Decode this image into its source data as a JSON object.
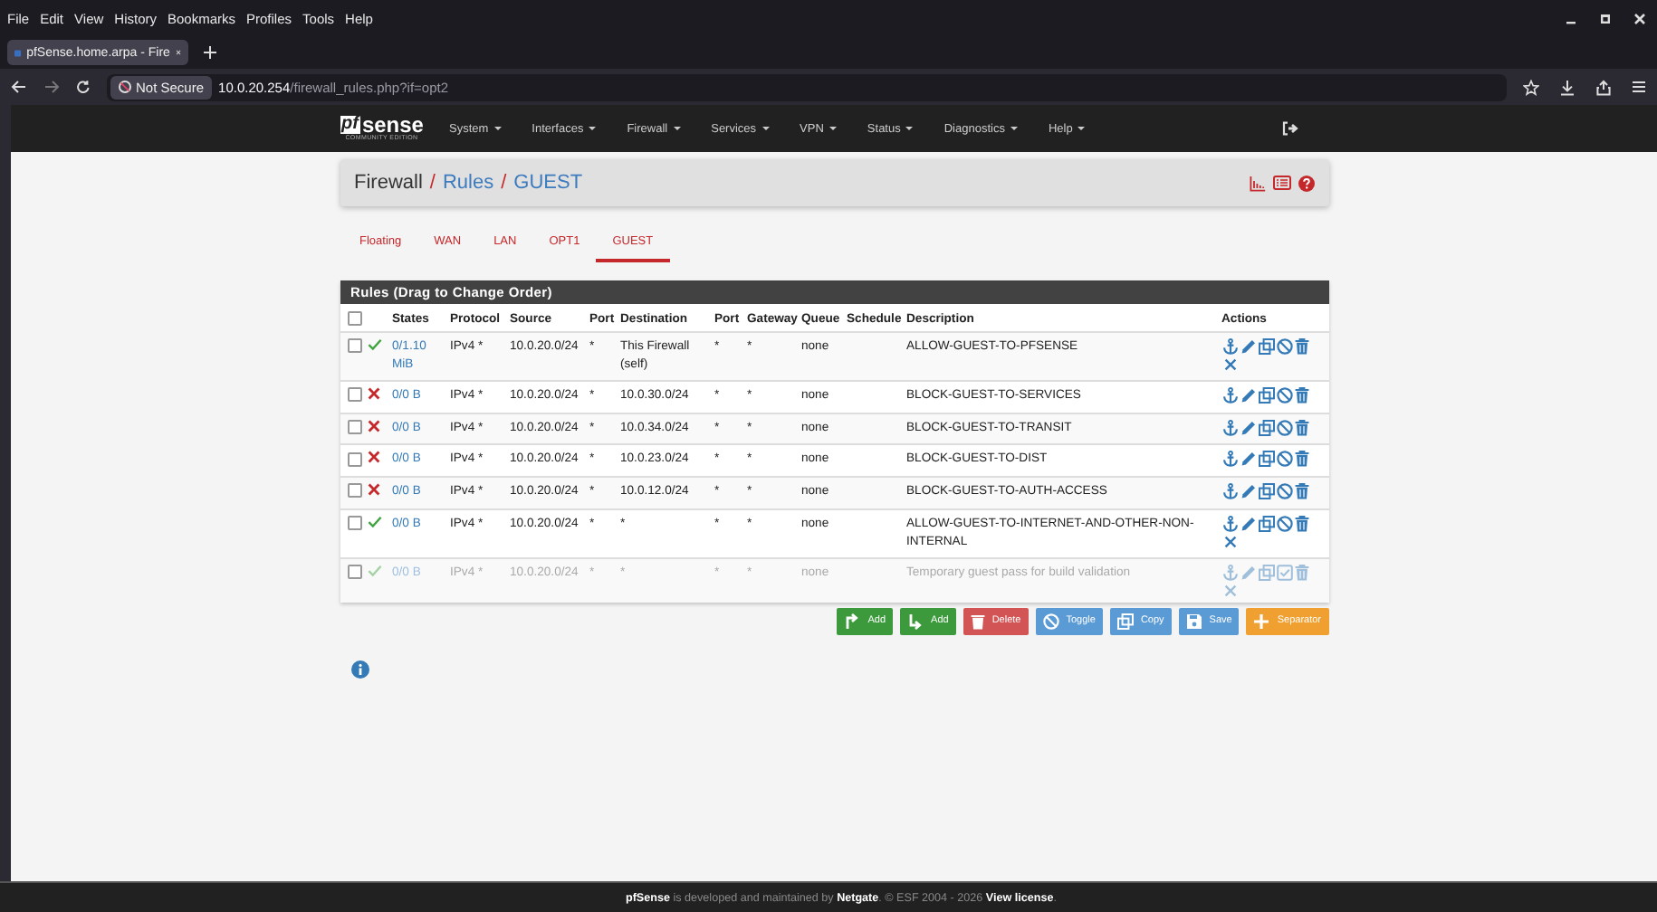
{
  "browser": {
    "menu": [
      "File",
      "Edit",
      "View",
      "History",
      "Bookmarks",
      "Profiles",
      "Tools",
      "Help"
    ],
    "tab": {
      "title": "pfSense.home.arpa - Fire",
      "selected": true
    },
    "address": {
      "security": "Not Secure",
      "host": "10.0.20.254",
      "path": "/firewall_rules.php?if=opt2"
    }
  },
  "navbar": {
    "logo": {
      "mark": "pf",
      "word": "sense",
      "edition": "COMMUNITY EDITION"
    },
    "menus": [
      "System",
      "Interfaces",
      "Firewall",
      "Services",
      "VPN",
      "Status",
      "Diagnostics",
      "Help"
    ]
  },
  "breadcrumb": {
    "separator": "/",
    "items": [
      {
        "text": "Firewall",
        "kind": "plain"
      },
      {
        "text": "Rules",
        "kind": "link"
      },
      {
        "text": "GUEST",
        "kind": "link"
      }
    ]
  },
  "tabs": [
    {
      "label": "Floating",
      "selected": false
    },
    {
      "label": "WAN",
      "selected": false
    },
    {
      "label": "LAN",
      "selected": false
    },
    {
      "label": "OPT1",
      "selected": false
    },
    {
      "label": "GUEST",
      "selected": true
    }
  ],
  "rules": {
    "title": "Rules (Drag to Change Order)",
    "select_all_checked": false,
    "columns": [
      "States",
      "Protocol",
      "Source",
      "Port",
      "Destination",
      "Port",
      "Gateway",
      "Queue",
      "Schedule",
      "Description",
      "Actions"
    ],
    "rows": [
      {
        "checked": false,
        "passes": true,
        "disabled": false,
        "states": "0/1.10 MiB",
        "protocol": "IPv4 *",
        "source": "10.0.20.0/24",
        "source_port": "*",
        "destination": "This Firewall (self)",
        "destination_port": "*",
        "gateway": "*",
        "queue": "none",
        "description": "ALLOW-GUEST-TO-PFSENSE",
        "x_action": true
      },
      {
        "checked": false,
        "passes": false,
        "disabled": false,
        "states": "0/0 B",
        "protocol": "IPv4 *",
        "source": "10.0.20.0/24",
        "source_port": "*",
        "destination": "10.0.30.0/24",
        "destination_port": "*",
        "gateway": "*",
        "queue": "none",
        "description": "BLOCK-GUEST-TO-SERVICES",
        "x_action": false
      },
      {
        "checked": false,
        "passes": false,
        "disabled": false,
        "states": "0/0 B",
        "protocol": "IPv4 *",
        "source": "10.0.20.0/24",
        "source_port": "*",
        "destination": "10.0.34.0/24",
        "destination_port": "*",
        "gateway": "*",
        "queue": "none",
        "description": "BLOCK-GUEST-TO-TRANSIT",
        "x_action": false
      },
      {
        "checked": false,
        "passes": false,
        "disabled": false,
        "states": "0/0 B",
        "protocol": "IPv4 *",
        "source": "10.0.20.0/24",
        "source_port": "*",
        "destination": "10.0.23.0/24",
        "destination_port": "*",
        "gateway": "*",
        "queue": "none",
        "description": "BLOCK-GUEST-TO-DIST",
        "x_action": false
      },
      {
        "checked": false,
        "passes": false,
        "disabled": false,
        "states": "0/0 B",
        "protocol": "IPv4 *",
        "source": "10.0.20.0/24",
        "source_port": "*",
        "destination": "10.0.12.0/24",
        "destination_port": "*",
        "gateway": "*",
        "queue": "none",
        "description": "BLOCK-GUEST-TO-AUTH-ACCESS",
        "x_action": false
      },
      {
        "checked": false,
        "passes": true,
        "disabled": false,
        "states": "0/0 B",
        "protocol": "IPv4 *",
        "source": "10.0.20.0/24",
        "source_port": "*",
        "destination": "*",
        "destination_port": "*",
        "gateway": "*",
        "queue": "none",
        "description": "ALLOW-GUEST-TO-INTERNET-AND-OTHER-NON-INTERNAL",
        "x_action": true
      },
      {
        "checked": false,
        "passes": true,
        "disabled": true,
        "states": "0/0 B",
        "protocol": "IPv4 *",
        "source": "10.0.20.0/24",
        "source_port": "*",
        "destination": "*",
        "destination_port": "*",
        "gateway": "*",
        "queue": "none",
        "description": "Temporary guest pass for build validation",
        "x_action": true
      }
    ]
  },
  "buttons": [
    {
      "label": "Add",
      "kind": "add_top"
    },
    {
      "label": "Add",
      "kind": "add_bottom"
    },
    {
      "label": "Delete",
      "kind": "delete"
    },
    {
      "label": "Toggle",
      "kind": "toggle"
    },
    {
      "label": "Copy",
      "kind": "copy"
    },
    {
      "label": "Save",
      "kind": "save"
    },
    {
      "label": "Separator",
      "kind": "separator"
    }
  ],
  "footer": "**pfSense** is developed and maintained by **Netgate**. © ESF 2004 - 2026 **View license**."
}
